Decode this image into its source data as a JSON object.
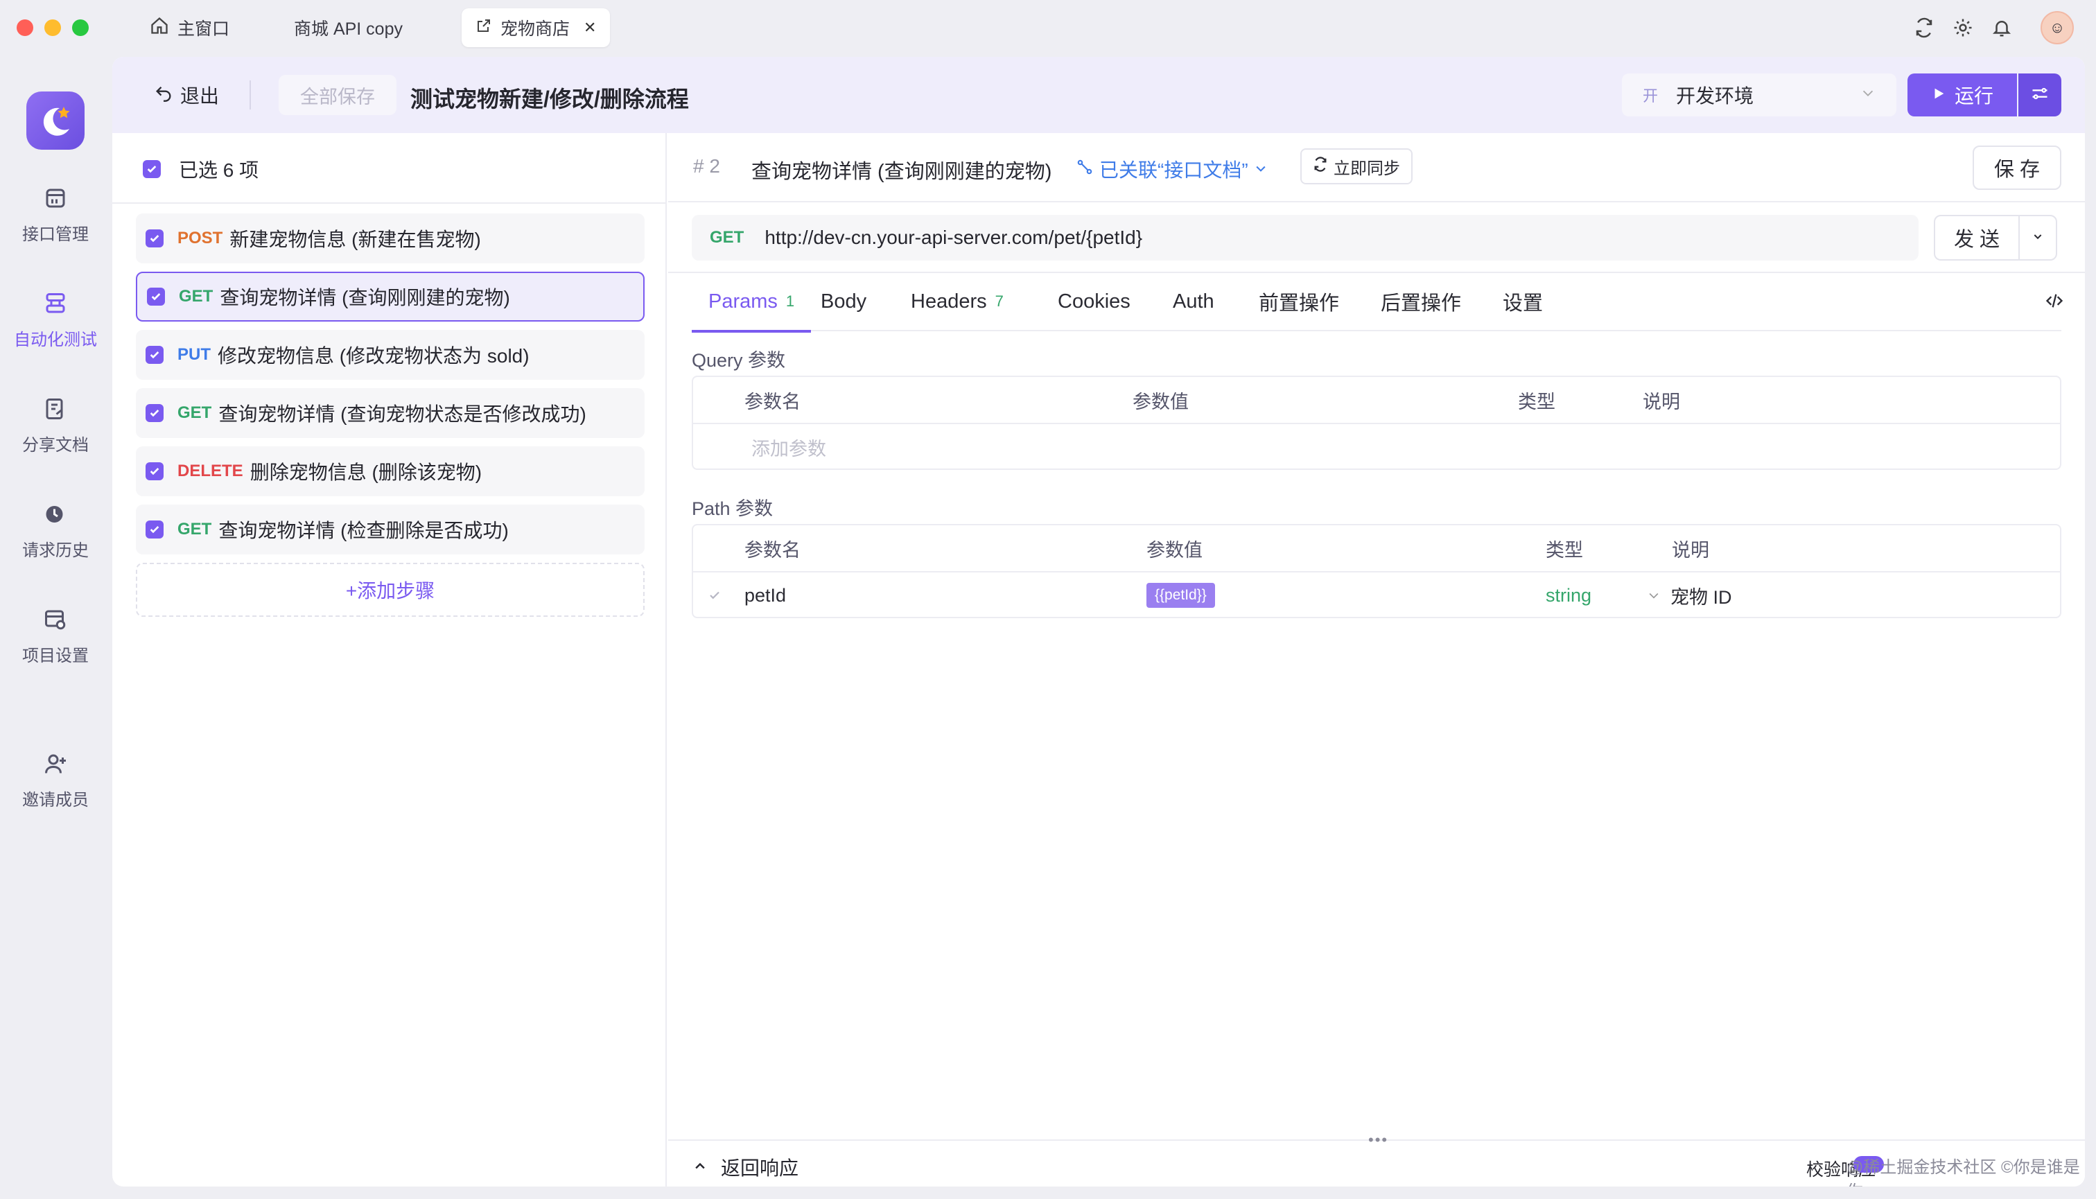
{
  "window": {
    "traffic_colors": [
      "#ff5f57",
      "#febc2e",
      "#28c840"
    ]
  },
  "tabs": [
    {
      "label": "主窗口",
      "icon": "home-icon"
    },
    {
      "label": "商城 API copy",
      "icon": ""
    },
    {
      "label": "宠物商店",
      "icon": "external-link-icon",
      "close": "✕"
    }
  ],
  "sidebar": {
    "items": [
      {
        "label": "接口管理",
        "icon": "api-icon"
      },
      {
        "label": "自动化测试",
        "icon": "automation-icon"
      },
      {
        "label": "分享文档",
        "icon": "share-doc-icon"
      },
      {
        "label": "请求历史",
        "icon": "history-icon"
      },
      {
        "label": "项目设置",
        "icon": "settings-icon"
      },
      {
        "label": "邀请成员",
        "icon": "invite-icon"
      }
    ]
  },
  "header": {
    "exit_label": "退出",
    "save_all_label": "全部保存",
    "title": "测试宠物新建/修改/删除流程",
    "env_badge": "开",
    "env_label": "开发环境",
    "run_label": "运行"
  },
  "left": {
    "selected_label": "已选 6 项",
    "steps": [
      {
        "method": "POST",
        "label": "新建宠物信息 (新建在售宠物)"
      },
      {
        "method": "GET",
        "label": "查询宠物详情 (查询刚刚建的宠物)"
      },
      {
        "method": "PUT",
        "label": "修改宠物信息 (修改宠物状态为 sold)"
      },
      {
        "method": "GET",
        "label": "查询宠物详情 (查询宠物状态是否修改成功)"
      },
      {
        "method": "DELETE",
        "label": "删除宠物信息 (删除该宠物)"
      },
      {
        "method": "GET",
        "label": "查询宠物详情 (检查删除是否成功)"
      }
    ],
    "add_step_label": "+添加步骤"
  },
  "detail": {
    "step_no": "# 2",
    "title": "查询宠物详情 (查询刚刚建的宠物)",
    "linked_label": "已关联“接口文档”",
    "sync_label": "立即同步",
    "save_label": "保 存",
    "method": "GET",
    "url": "http://dev-cn.your-api-server.com/pet/{petId}",
    "send_label": "发 送",
    "tabs": [
      {
        "label": "Params",
        "count": "1"
      },
      {
        "label": "Body",
        "count": ""
      },
      {
        "label": "Headers",
        "count": "7"
      },
      {
        "label": "Cookies",
        "count": ""
      },
      {
        "label": "Auth",
        "count": ""
      },
      {
        "label": "前置操作",
        "count": ""
      },
      {
        "label": "后置操作",
        "count": ""
      },
      {
        "label": "设置",
        "count": ""
      }
    ],
    "query": {
      "label": "Query 参数",
      "headers": [
        "参数名",
        "参数值",
        "类型",
        "说明"
      ],
      "add_placeholder": "添加参数"
    },
    "path": {
      "label": "Path 参数",
      "headers": [
        "参数名",
        "参数值",
        "类型",
        "说明"
      ],
      "rows": [
        {
          "name": "petId",
          "value": "{{petId}}",
          "type": "string",
          "desc": "宠物 ID"
        }
      ]
    },
    "bottom": {
      "response_label": "返回响应",
      "verify_label": "校验响应",
      "watermark": "@稀土掘金技术社区 ©你是谁是你"
    }
  }
}
